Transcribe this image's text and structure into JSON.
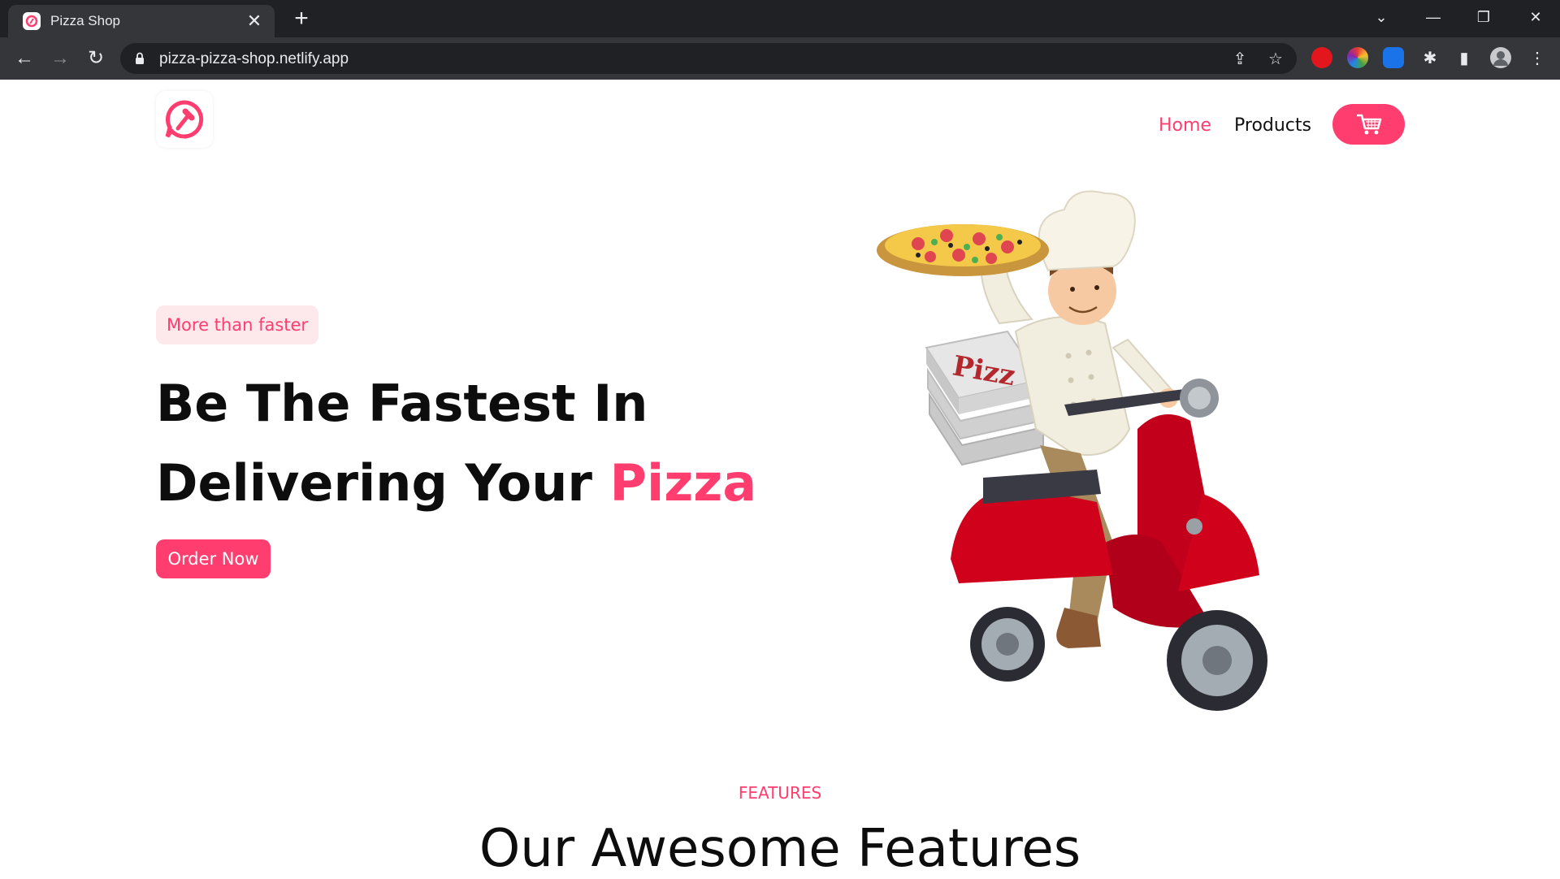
{
  "browser": {
    "tab_title": "Pizza Shop",
    "tab_close": "✕",
    "new_tab": "+",
    "url": "pizza-pizza-shop.netlify.app",
    "window_controls": {
      "tab_search": "⌄",
      "minimize": "—",
      "restore": "❐",
      "close": "✕"
    },
    "nav": {
      "back": "←",
      "forward": "→",
      "reload": "↻"
    },
    "omnibox_icons": {
      "share": "⇪",
      "bookmark": "☆"
    },
    "extensions": [
      {
        "name": "adblock-extension-icon",
        "color": "#e3161e"
      },
      {
        "name": "color-picker-extension-icon",
        "color": "#4caf50"
      },
      {
        "name": "blue-extension-icon",
        "color": "#1a73e8"
      }
    ],
    "toolbar_icons": {
      "extensions": "✱",
      "side_panel": "▮",
      "menu": "⋮"
    }
  },
  "site": {
    "nav": {
      "home": "Home",
      "products": "Products"
    },
    "cart_icon": "shopping-cart-icon",
    "hero": {
      "badge": "More than faster",
      "line1": "Be The Fastest In",
      "line2_main": "Delivering Your ",
      "line2_accent": "Pizza",
      "cta": "Order Now"
    },
    "features": {
      "label": "FEATURES",
      "title": "Our Awesome Features"
    }
  },
  "colors": {
    "accent": "#ff3d6f",
    "badge_bg": "#fde8ec",
    "chrome_dark": "#202124",
    "chrome_mid": "#35363a",
    "scooter_red": "#d0021b"
  }
}
